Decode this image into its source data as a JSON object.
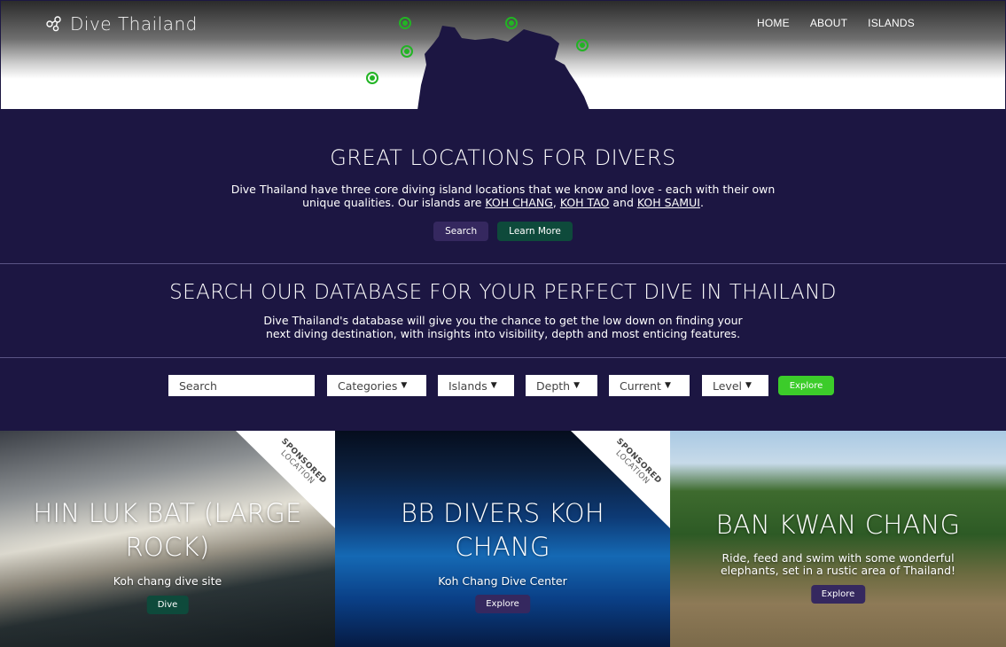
{
  "header": {
    "logo_text": "Dive Thailand",
    "nav": [
      "HOME",
      "ABOUT",
      "ISLANDS"
    ]
  },
  "intro": {
    "title": "GREAT LOCATIONS FOR DIVERS",
    "text_before": "Dive Thailand have three core diving island locations that we know and love - each with their own unique qualities. Our islands are ",
    "island1": "KOH CHANG",
    "sep1": ", ",
    "island2": "KOH TAO",
    "sep2": " and ",
    "island3": "KOH SAMUI",
    "text_after": ".",
    "search_button": "Search",
    "learn_button": "Learn More"
  },
  "database": {
    "title": "SEARCH OUR DATABASE FOR YOUR PERFECT DIVE IN THAILAND",
    "text": "Dive Thailand's database will give you the chance to get the low down on finding your next diving destination, with insights into visibility, depth and most enticing features."
  },
  "filters": {
    "search_value": "Search",
    "categories": "Categories",
    "islands": "Islands",
    "depth": "Depth",
    "current": "Current",
    "level": "Level",
    "explore": "Explore"
  },
  "cards": [
    {
      "title": "HIN LUK BAT (LARGE ROCK)",
      "subtitle": "Koh chang dive site",
      "button": "Dive",
      "button_color": "#0e4a3b",
      "sponsored": [
        "SPONSORED",
        "LOCATION"
      ]
    },
    {
      "title": "BB DIVERS KOH CHANG",
      "subtitle": "Koh Chang Dive Center",
      "button": "Explore",
      "button_color": "#35285f",
      "sponsored": [
        "SPONSORED",
        "LOCATION"
      ]
    },
    {
      "title": "BAN KWAN CHANG",
      "subtitle": "Ride, feed and swim with some wonderful elephants, set in a rustic area of Thailand!",
      "button": "Explore",
      "button_color": "#35285f"
    }
  ],
  "colors": {
    "navy": "#1c1642",
    "green_accent": "#3ccc2a",
    "marker_green": "#22b424",
    "dark_green": "#0e4a3b"
  },
  "icons": {
    "logo": "molecule-icon",
    "map_markers": "location-pin-icon",
    "dropdowns": "chevron-down-icon"
  }
}
